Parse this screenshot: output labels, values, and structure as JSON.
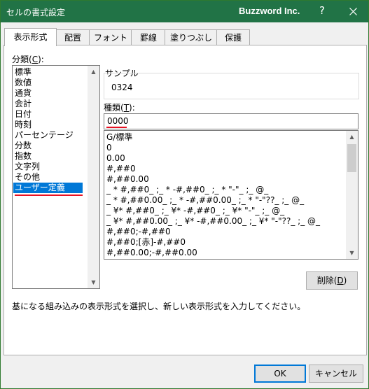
{
  "window": {
    "title": "セルの書式設定",
    "brand": "Buzzword Inc.",
    "help": "?",
    "close_icon": "close-icon"
  },
  "tabs": [
    {
      "label": "表示形式",
      "active": true
    },
    {
      "label": "配置"
    },
    {
      "label": "フォント"
    },
    {
      "label": "罫線"
    },
    {
      "label": "塗りつぶし"
    },
    {
      "label": "保護"
    }
  ],
  "category": {
    "label": "分類(C):",
    "label_prefix": "分類(",
    "label_key": "C",
    "label_suffix": "):",
    "items": [
      "標準",
      "数値",
      "通貨",
      "会計",
      "日付",
      "時刻",
      "パーセンテージ",
      "分数",
      "指数",
      "文字列",
      "その他",
      "ユーザー定義"
    ],
    "selected": "ユーザー定義"
  },
  "sample": {
    "label": "サンプル",
    "value": "0324"
  },
  "type": {
    "label_prefix": "種類(",
    "label_key": "T",
    "label_suffix": "):",
    "value": "0000",
    "items": [
      "G/標準",
      "0",
      "0.00",
      "#,##0",
      "#,##0.00",
      "_ * #,##0_ ;_ * -#,##0_ ;_ * \"-\"_ ;_ @_",
      "_ * #,##0.00_ ;_ * -#,##0.00_ ;_ * \"-\"??_ ;_ @_",
      "_ ¥* #,##0_ ;_ ¥* -#,##0_ ;_ ¥* \"-\"_ ;_ @_",
      "_ ¥* #,##0.00_ ;_ ¥* -#,##0.00_ ;_ ¥* \"-\"??_ ;_ @_",
      "#,##0;-#,##0",
      "#,##0;[赤]-#,##0",
      "#,##0.00;-#,##0.00"
    ]
  },
  "delete_button": {
    "prefix": "削除(",
    "key": "D",
    "suffix": ")"
  },
  "description": "基になる組み込みの表示形式を選択し、新しい表示形式を入力してください。",
  "ok_button": "OK",
  "cancel_button": "キャンセル",
  "colors": {
    "titlebar": "#217346",
    "selection": "#0078d7",
    "highlight_underline": "#e81123"
  }
}
